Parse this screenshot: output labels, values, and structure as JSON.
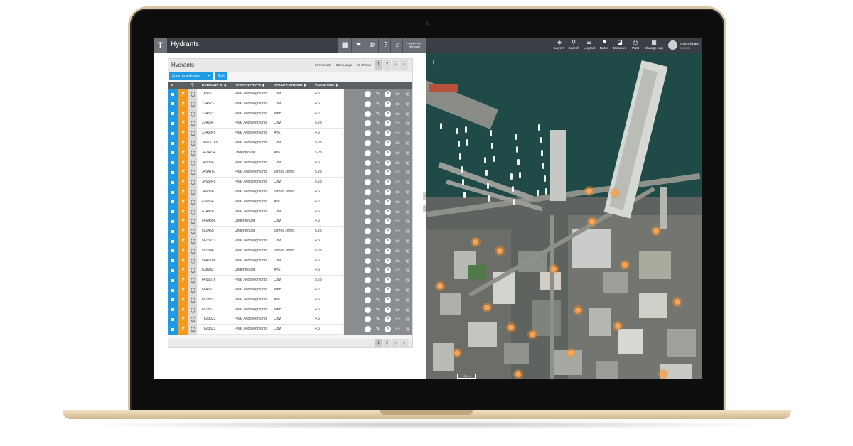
{
  "app": {
    "title": "Hydrants",
    "template_label": "tmapy tmapy Template"
  },
  "panel": {
    "title": "Hydrants",
    "records": "33 Records",
    "per_page": "25 on page",
    "shown": "33 Shown",
    "pages": [
      "1",
      "2"
    ],
    "next": "›",
    "last": "»",
    "zoom_button": "Zoom to selection",
    "edit_button": "Edit"
  },
  "columns": [
    "HYDRANT ID",
    "HYDRANT TYPE",
    "MANUFACTURER",
    "VALVE SIZE"
  ],
  "rows": [
    [
      "16517",
      "Pillar / Aboveground",
      "Clow",
      "4.5"
    ],
    [
      "234523",
      "Pillar / Aboveground",
      "Clow",
      "4.5"
    ],
    [
      "234552",
      "Pillar / Aboveground",
      "M&H",
      "4.5"
    ],
    [
      "234634",
      "Pillar / Aboveground",
      "Clow",
      "5.25"
    ],
    [
      "2346345",
      "Pillar / Aboveground",
      "AVK",
      "4.5"
    ],
    [
      "24677765",
      "Pillar / Aboveground",
      "Clow",
      "5.25"
    ],
    [
      "3424234",
      "Underground",
      "AVK",
      "5.25"
    ],
    [
      "345354",
      "Pillar / Aboveground",
      "Clow",
      "4.5"
    ],
    [
      "3454787",
      "Pillar / Aboveground",
      "James Jones",
      "5.25"
    ],
    [
      "3455345",
      "Pillar / Aboveground",
      "Clow",
      "5.25"
    ],
    [
      "346356",
      "Pillar / Aboveground",
      "James Jones",
      "4.5"
    ],
    [
      "436564",
      "Pillar / Aboveground",
      "AVK",
      "4.5"
    ],
    [
      "474878",
      "Pillar / Aboveground",
      "Clow",
      "4.5"
    ],
    [
      "5464356",
      "Underground",
      "Clow",
      "4.5"
    ],
    [
      "552455",
      "Underground",
      "James Jones",
      "5.25"
    ],
    [
      "5673223",
      "Pillar / Aboveground",
      "Clow",
      "4.5"
    ],
    [
      "597546",
      "Pillar / Aboveground",
      "James Jones",
      "5.25"
    ],
    [
      "5645788",
      "Pillar / Aboveground",
      "Clow",
      "4.5"
    ],
    [
      "638982",
      "Underground",
      "AVK",
      "4.5"
    ],
    [
      "6456576",
      "Pillar / Aboveground",
      "Clow",
      "5.25"
    ],
    [
      "654657",
      "Pillar / Aboveground",
      "M&H",
      "4.5"
    ],
    [
      "657832",
      "Pillar / Aboveground",
      "AVK",
      "4.5"
    ],
    [
      "65786",
      "Pillar / Aboveground",
      "M&H",
      "4.5"
    ],
    [
      "7623323",
      "Pillar / Aboveground",
      "Clow",
      "4.5"
    ],
    [
      "7623323",
      "Pillar / Aboveground",
      "Clow",
      "4.5"
    ]
  ],
  "toolbar": [
    {
      "label": "Layers",
      "icon": "layers-icon"
    },
    {
      "label": "Search",
      "icon": "search-icon"
    },
    {
      "label": "Legend",
      "icon": "legend-icon"
    },
    {
      "label": "Notes",
      "icon": "pin-icon"
    },
    {
      "label": "Measure",
      "icon": "measure-icon"
    },
    {
      "label": "Print",
      "icon": "print-icon"
    },
    {
      "label": "Change app",
      "icon": "apps-icon"
    }
  ],
  "user": {
    "name": "tmapy tmapy",
    "sub": "TOOLKIT"
  },
  "map": {
    "zoom_in": "+",
    "zoom_out": "−",
    "scale": "100 m"
  },
  "colors": {
    "accent_blue": "#1e9be4",
    "accent_orange": "#f49a1c",
    "toolbar_dark": "#3a3f45",
    "hydrant_marker": "#f5a45a"
  }
}
